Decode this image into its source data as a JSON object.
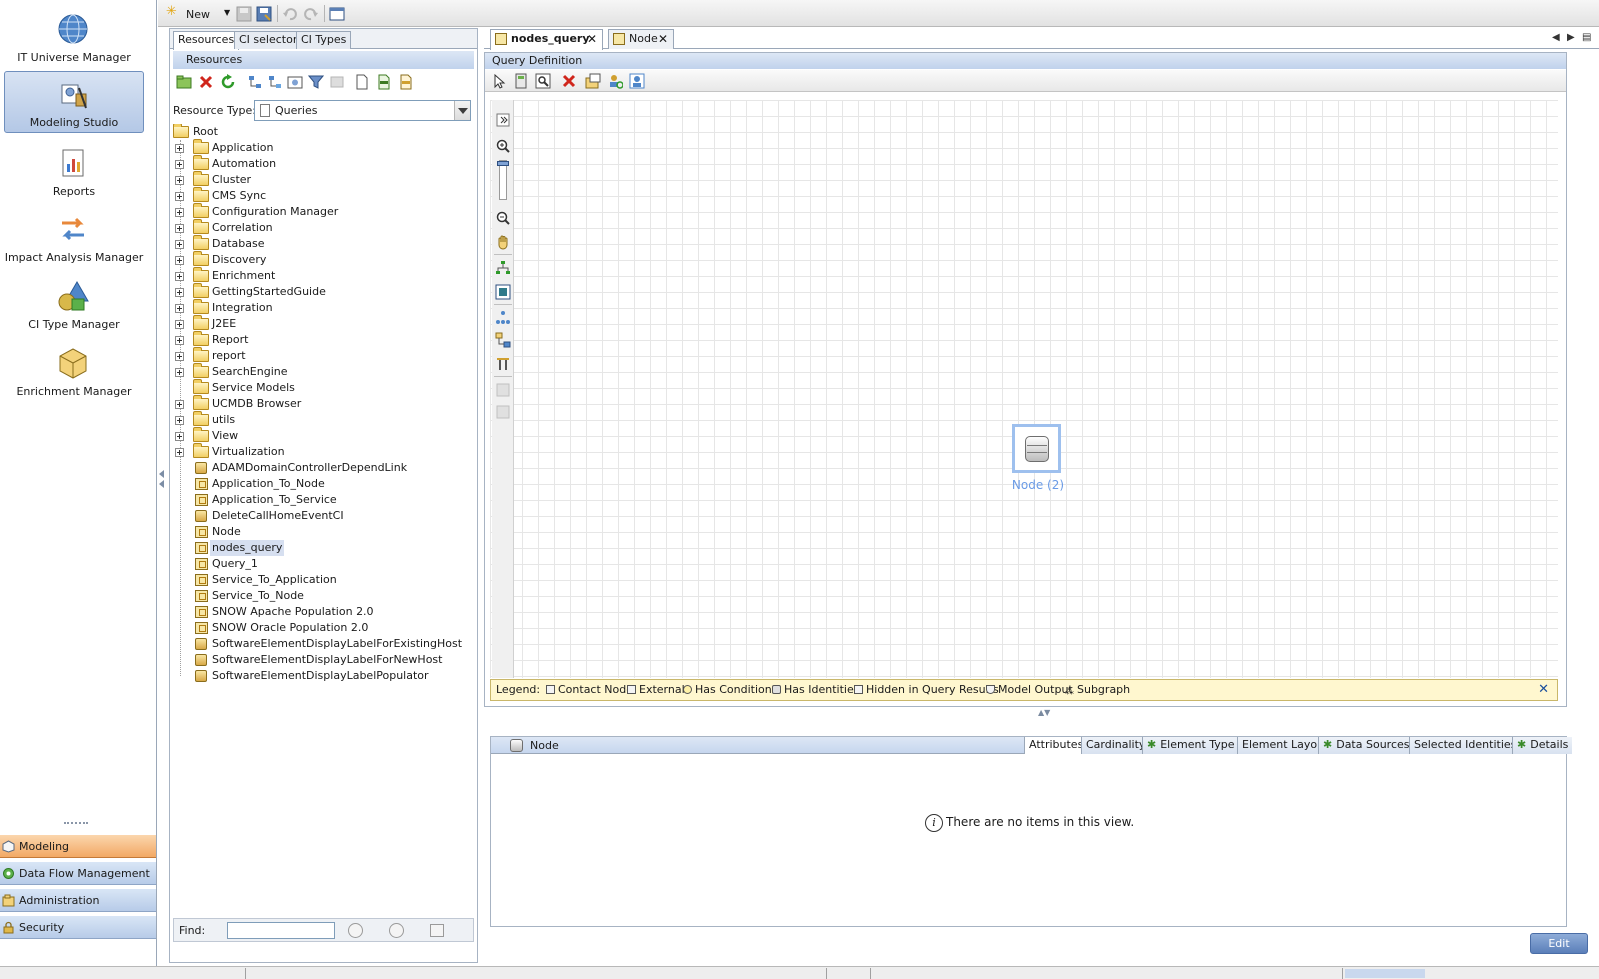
{
  "left_nav": {
    "modules": [
      {
        "label": "IT Universe Manager",
        "icon": "globe-icon"
      },
      {
        "label": "Modeling Studio",
        "icon": "modeling-studio-icon",
        "active": true
      },
      {
        "label": "Reports",
        "icon": "report-chart-icon"
      },
      {
        "label": "Impact Analysis Manager",
        "icon": "impact-arrows-icon"
      },
      {
        "label": "CI Type Manager",
        "icon": "shapes-icon"
      },
      {
        "label": "Enrichment Manager",
        "icon": "cube-icon"
      }
    ],
    "sections": [
      {
        "label": "Modeling",
        "icon": "modeling-icon",
        "active": true
      },
      {
        "label": "Data Flow Management",
        "icon": "data-flow-icon"
      },
      {
        "label": "Administration",
        "icon": "administration-icon"
      },
      {
        "label": "Security",
        "icon": "lock-icon"
      }
    ]
  },
  "toolbar": {
    "new_label": "New"
  },
  "resources": {
    "tabs": [
      "Resources",
      "CI selector",
      "CI Types"
    ],
    "header": "Resources",
    "resource_type_label": "Resource Type:",
    "resource_type_value": "Queries",
    "root_label": "Root",
    "folders": [
      "Application",
      "Automation",
      "Cluster",
      "CMS Sync",
      "Configuration Manager",
      "Correlation",
      "Database",
      "Discovery",
      "Enrichment",
      "GettingStartedGuide",
      "Integration",
      "J2EE",
      "Report",
      "report",
      "SearchEngine",
      "Service Models",
      "UCMDB Browser",
      "utils",
      "View",
      "Virtualization"
    ],
    "queries": [
      {
        "label": "ADAMDomainControllerDependLink",
        "kind": "enrichment"
      },
      {
        "label": "Application_To_Node",
        "kind": "query"
      },
      {
        "label": "Application_To_Service",
        "kind": "query"
      },
      {
        "label": "DeleteCallHomeEventCI",
        "kind": "enrichment"
      },
      {
        "label": "Node",
        "kind": "query"
      },
      {
        "label": "nodes_query",
        "kind": "query",
        "selected": true
      },
      {
        "label": "Query_1",
        "kind": "query"
      },
      {
        "label": "Service_To_Application",
        "kind": "query"
      },
      {
        "label": "Service_To_Node",
        "kind": "query"
      },
      {
        "label": "SNOW Apache Population 2.0",
        "kind": "query"
      },
      {
        "label": "SNOW Oracle Population 2.0",
        "kind": "query"
      },
      {
        "label": "SoftwareElementDisplayLabelForExistingHost",
        "kind": "enrichment"
      },
      {
        "label": "SoftwareElementDisplayLabelForNewHost",
        "kind": "enrichment"
      },
      {
        "label": "SoftwareElementDisplayLabelPopulator",
        "kind": "enrichment"
      }
    ],
    "find_label": "Find:",
    "find_value": ""
  },
  "editor": {
    "tabs": [
      {
        "label": "nodes_query",
        "active": true
      },
      {
        "label": "Node",
        "active": false
      }
    ],
    "query_definition_title": "Query Definition",
    "node_label": "Node (2)",
    "legend": {
      "title": "Legend:",
      "items": [
        "Contact Node",
        "External",
        "Has Conditions",
        "Has Identities",
        "Hidden in Query Results",
        "Model Output",
        "Subgraph"
      ]
    }
  },
  "details": {
    "title": "Node",
    "tabs": [
      {
        "label": "Attributes",
        "active": true,
        "star": false
      },
      {
        "label": "Cardinality",
        "star": false
      },
      {
        "label": "Element Type",
        "star": true
      },
      {
        "label": "Element Layout",
        "star": false
      },
      {
        "label": "Data Sources",
        "star": true
      },
      {
        "label": "Selected Identities",
        "star": false
      },
      {
        "label": "Details",
        "star": true
      }
    ],
    "empty_message": "There are no items in this view.",
    "edit_label": "Edit"
  },
  "colors": {
    "accent": "#6a9be6",
    "active_section": "#f2a965",
    "panel_header": "#c0d2ec",
    "legend_background": "#fff7cf"
  }
}
